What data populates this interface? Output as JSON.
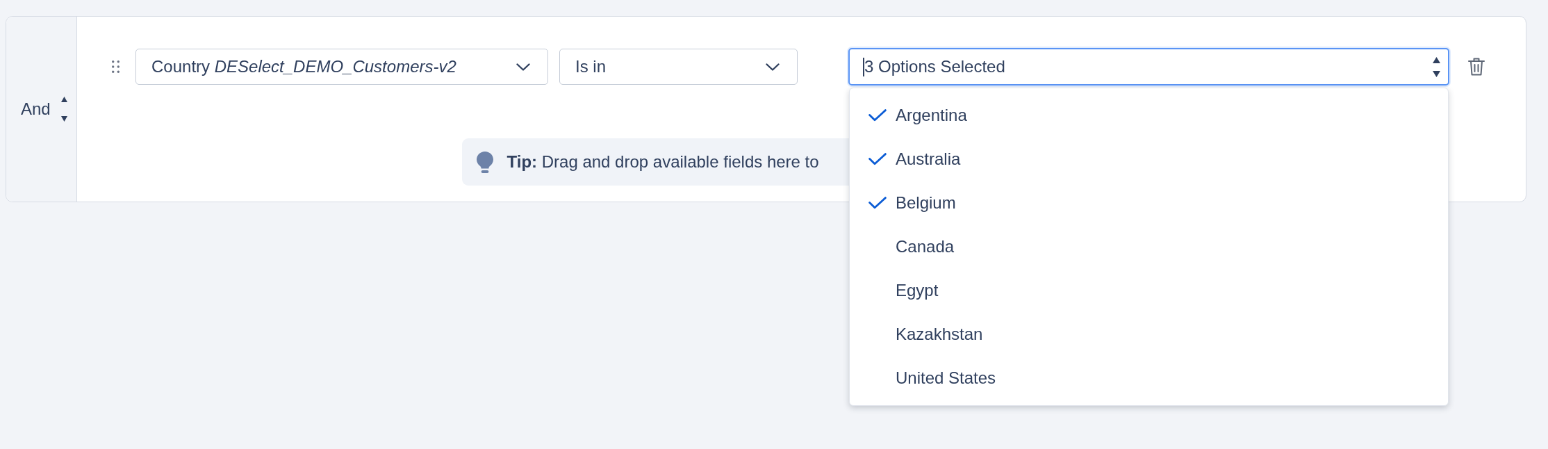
{
  "logic_toggle": {
    "label": "And"
  },
  "condition": {
    "field": {
      "label": "Country *DESelect_DEMO_Customers-v2*"
    },
    "operator": {
      "label": "Is in"
    },
    "values": {
      "summary": "3 Options Selected",
      "focused": true,
      "options": [
        {
          "label": "Argentina",
          "selected": true
        },
        {
          "label": "Australia",
          "selected": true
        },
        {
          "label": "Belgium",
          "selected": true
        },
        {
          "label": "Canada",
          "selected": false
        },
        {
          "label": "Egypt",
          "selected": false
        },
        {
          "label": "Kazakhstan",
          "selected": false
        },
        {
          "label": "United States",
          "selected": false
        }
      ]
    }
  },
  "tip": {
    "text": "**Tip:** Drag and drop available fields here to"
  }
}
